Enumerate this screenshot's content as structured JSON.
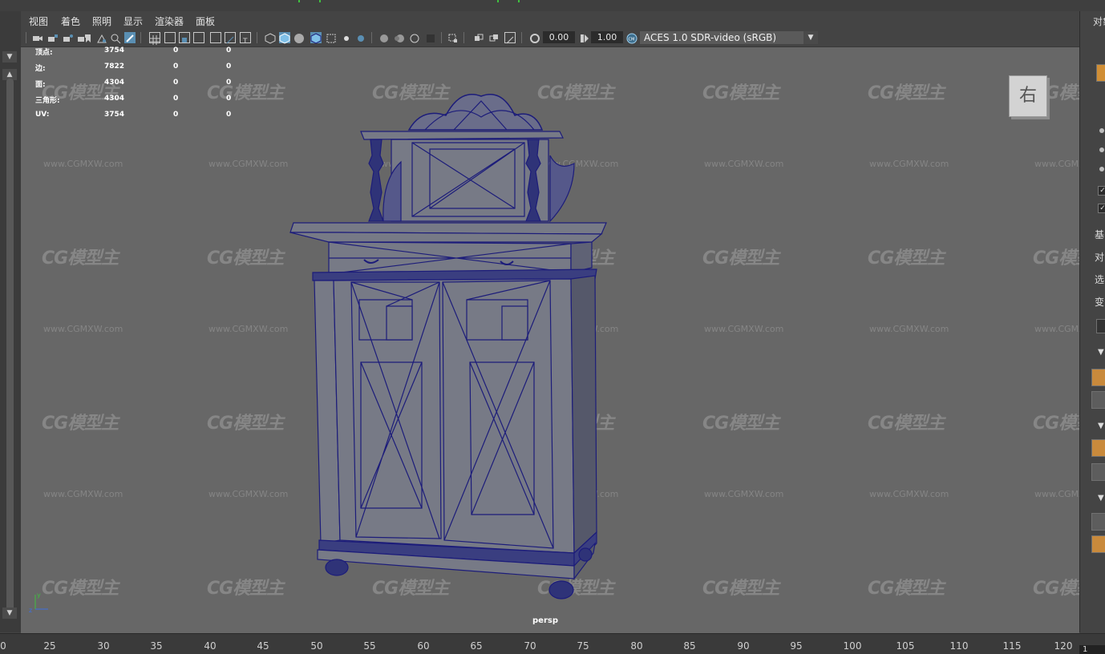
{
  "window": {
    "menus": [
      "视图",
      "着色",
      "照明",
      "显示",
      "渲染器",
      "面板"
    ]
  },
  "toolbar": {
    "exposure_value": "0.00",
    "gamma_value": "1.00",
    "color_space": "ACES 1.0 SDR-video (sRGB)"
  },
  "stats": [
    {
      "label": "顶点:",
      "a": "3754",
      "b": "0",
      "c": "0"
    },
    {
      "label": "边:",
      "a": "7822",
      "b": "0",
      "c": "0"
    },
    {
      "label": "面:",
      "a": "4304",
      "b": "0",
      "c": "0"
    },
    {
      "label": "三角形:",
      "a": "4304",
      "b": "0",
      "c": "0"
    },
    {
      "label": "UV:",
      "a": "3754",
      "b": "0",
      "c": "0"
    }
  ],
  "viewport": {
    "camera_label": "persp",
    "viewcube_face": "右",
    "axis_y": "y",
    "axis_z": "z"
  },
  "watermark": {
    "logo": "CG模型主",
    "url": "www.CGMXW.com"
  },
  "right_panel": {
    "labels": [
      "对象",
      "基",
      "对",
      "选",
      "变"
    ]
  },
  "timeline": {
    "ticks": [
      "0",
      "25",
      "30",
      "35",
      "40",
      "45",
      "50",
      "55",
      "60",
      "65",
      "70",
      "75",
      "80",
      "85",
      "90",
      "95",
      "100",
      "105",
      "110",
      "115",
      "120"
    ],
    "current_frame": "1"
  },
  "colors": {
    "viewport_bg": "#676767",
    "wire": "#1c1c7a",
    "ui_bg": "#444444",
    "highlight": "#5a8fb3"
  }
}
